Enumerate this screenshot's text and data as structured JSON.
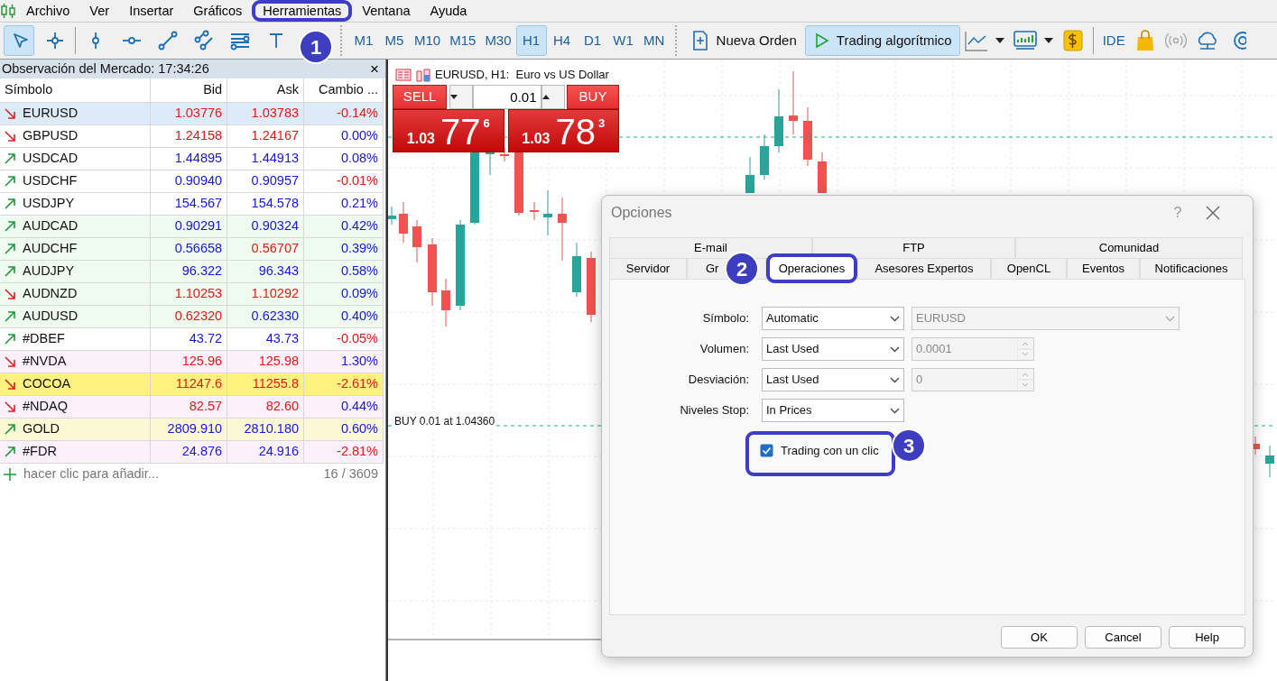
{
  "menu": [
    {
      "label": "Archivo"
    },
    {
      "label": "Ver"
    },
    {
      "label": "Insertar"
    },
    {
      "label": "Gráficos"
    },
    {
      "label": "Herramientas"
    },
    {
      "label": "Ventana"
    },
    {
      "label": "Ayuda"
    }
  ],
  "toolbar": {
    "tools": [
      {
        "kind": "cursor",
        "selected": true
      },
      {
        "kind": "crosshair",
        "selected": false
      },
      {
        "kind": "vline",
        "selected": false
      },
      {
        "kind": "hline",
        "selected": false
      },
      {
        "kind": "trendline",
        "selected": false
      },
      {
        "kind": "channel",
        "selected": false
      },
      {
        "kind": "fibo",
        "selected": false
      },
      {
        "kind": "text",
        "selected": false
      }
    ],
    "timeframes": [
      {
        "label": "M1",
        "selected": false
      },
      {
        "label": "M5",
        "selected": false
      },
      {
        "label": "M10",
        "selected": false
      },
      {
        "label": "M15",
        "selected": false
      },
      {
        "label": "M30",
        "selected": false
      },
      {
        "label": "H1",
        "selected": true
      },
      {
        "label": "H4",
        "selected": false
      },
      {
        "label": "D1",
        "selected": false
      },
      {
        "label": "W1",
        "selected": false
      },
      {
        "label": "MN",
        "selected": false
      }
    ],
    "buttons": [
      {
        "label": "Nueva Orden",
        "active": false
      },
      {
        "label": "Trading algorítmico",
        "active": true
      }
    ],
    "ide_label": "IDE"
  },
  "market_watch": {
    "title": "Observación del Mercado: 17:34:26",
    "close": "×",
    "columns": [
      "Símbolo",
      "Bid",
      "Ask",
      "Cambio ..."
    ],
    "rows": [
      {
        "symbol": "EURUSD",
        "rising": false,
        "bid": "1.03776",
        "bid_down": true,
        "ask": "1.03783",
        "ask_down": true,
        "change": "-0.14%",
        "change_down": true,
        "color": "#ddebf9"
      },
      {
        "symbol": "GBPUSD",
        "rising": false,
        "bid": "1.24158",
        "bid_down": true,
        "ask": "1.24167",
        "ask_down": true,
        "change": "0.00%",
        "change_down": false,
        "color": "#ffffff"
      },
      {
        "symbol": "USDCAD",
        "rising": true,
        "bid": "1.44895",
        "bid_down": false,
        "ask": "1.44913",
        "ask_down": false,
        "change": "0.08%",
        "change_down": false,
        "color": "#ffffff"
      },
      {
        "symbol": "USDCHF",
        "rising": true,
        "bid": "0.90940",
        "bid_down": false,
        "ask": "0.90957",
        "ask_down": false,
        "change": "-0.01%",
        "change_down": true,
        "color": "#ffffff"
      },
      {
        "symbol": "USDJPY",
        "rising": true,
        "bid": "154.567",
        "bid_down": false,
        "ask": "154.578",
        "ask_down": false,
        "change": "0.21%",
        "change_down": false,
        "color": "#ffffff"
      },
      {
        "symbol": "AUDCAD",
        "rising": true,
        "bid": "0.90291",
        "bid_down": false,
        "ask": "0.90324",
        "ask_down": false,
        "change": "0.42%",
        "change_down": false,
        "color": "#effbef"
      },
      {
        "symbol": "AUDCHF",
        "rising": true,
        "bid": "0.56658",
        "bid_down": false,
        "ask": "0.56707",
        "ask_down": true,
        "change": "0.39%",
        "change_down": false,
        "color": "#effbef"
      },
      {
        "symbol": "AUDJPY",
        "rising": true,
        "bid": "96.322",
        "bid_down": false,
        "ask": "96.343",
        "ask_down": false,
        "change": "0.58%",
        "change_down": false,
        "color": "#effbef"
      },
      {
        "symbol": "AUDNZD",
        "rising": false,
        "bid": "1.10253",
        "bid_down": true,
        "ask": "1.10292",
        "ask_down": true,
        "change": "0.09%",
        "change_down": false,
        "color": "#effbef"
      },
      {
        "symbol": "AUDUSD",
        "rising": true,
        "bid": "0.62320",
        "bid_down": true,
        "ask": "0.62330",
        "ask_down": false,
        "change": "0.40%",
        "change_down": false,
        "color": "#effbef"
      },
      {
        "symbol": "#DBEF",
        "rising": true,
        "bid": "43.72",
        "bid_down": false,
        "ask": "43.73",
        "ask_down": false,
        "change": "-0.05%",
        "change_down": true,
        "color": "#ffffff"
      },
      {
        "symbol": "#NVDA",
        "rising": false,
        "bid": "125.96",
        "bid_down": true,
        "ask": "125.98",
        "ask_down": true,
        "change": "1.30%",
        "change_down": false,
        "color": "#fdf0fd"
      },
      {
        "symbol": "COCOA",
        "rising": false,
        "bid": "11247.6",
        "bid_down": true,
        "ask": "11255.8",
        "ask_down": true,
        "change": "-2.61%",
        "change_down": true,
        "color": "#fff27f"
      },
      {
        "symbol": "#NDAQ",
        "rising": false,
        "bid": "82.57",
        "bid_down": true,
        "ask": "82.60",
        "ask_down": true,
        "change": "0.44%",
        "change_down": false,
        "color": "#fdf0fd"
      },
      {
        "symbol": "GOLD",
        "rising": true,
        "bid": "2809.910",
        "bid_down": false,
        "ask": "2810.180",
        "ask_down": false,
        "change": "0.60%",
        "change_down": false,
        "color": "#fdf8d4"
      },
      {
        "symbol": "#FDR",
        "rising": true,
        "bid": "24.876",
        "bid_down": false,
        "ask": "24.916",
        "ask_down": false,
        "change": "-2.81%",
        "change_down": true,
        "color": "#fdf0fd"
      }
    ],
    "add_label": "hacer clic para añadir...",
    "count": "16 / 3609"
  },
  "chart": {
    "title": "EURUSD, H1:  Euro vs US Dollar",
    "sell": "SELL",
    "buy": "BUY",
    "volume": "0.01",
    "sell_price": {
      "prefix": "1.03",
      "main": "77",
      "sup": "6"
    },
    "buy_price": {
      "prefix": "1.03",
      "main": "78",
      "sup": "3"
    },
    "order_line": "BUY 0.01 at 1.04360"
  },
  "dialog": {
    "title": "Opciones",
    "help": "?",
    "tab_rows": [
      [
        {
          "label": "E-mail",
          "selected": false
        },
        {
          "label": "FTP",
          "selected": false
        },
        {
          "label": "Comunidad",
          "selected": false
        }
      ],
      [
        {
          "label": "Servidor",
          "selected": false
        },
        {
          "label": "Gr",
          "selected": false
        },
        {
          "label": "Operaciones",
          "selected": true
        },
        {
          "label": "Asesores Expertos",
          "selected": false
        },
        {
          "label": "OpenCL",
          "selected": false
        },
        {
          "label": "Eventos",
          "selected": false
        },
        {
          "label": "Notificaciones",
          "selected": false
        }
      ]
    ],
    "fields": [
      {
        "label": "Símbolo:",
        "value": "Automatic",
        "extra": {
          "kind": "select",
          "value": "EURUSD",
          "disabled": true
        }
      },
      {
        "label": "Volumen:",
        "value": "Last Used",
        "extra": {
          "kind": "spin",
          "value": "0.0001",
          "disabled": true
        }
      },
      {
        "label": "Desviación:",
        "value": "Last Used",
        "extra": {
          "kind": "spin",
          "value": "0",
          "disabled": true
        }
      },
      {
        "label": "Niveles Stop:",
        "value": "In Prices"
      }
    ],
    "checkbox": {
      "label": "Trading con un clic",
      "checked": true
    },
    "buttons": [
      "OK",
      "Cancel",
      "Help"
    ]
  },
  "annotations": [
    {
      "number": "1"
    },
    {
      "number": "2"
    },
    {
      "number": "3"
    }
  ]
}
